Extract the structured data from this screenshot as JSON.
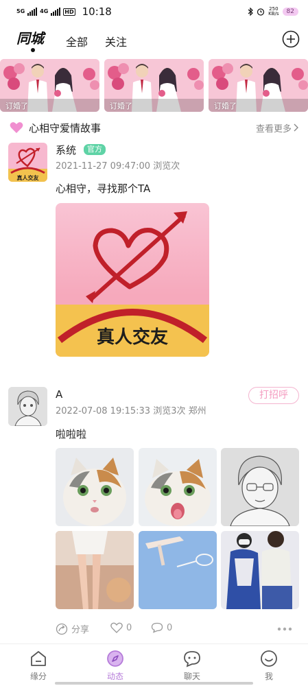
{
  "status_bar": {
    "net1": "5G",
    "net2": "4G",
    "hd": "HD",
    "time": "10:18",
    "speed_value": "250",
    "speed_unit": "KB/s",
    "battery": "82"
  },
  "top_nav": {
    "active_tab": "同城",
    "tabs": [
      "全部",
      "关注"
    ],
    "add_icon": "plus-circle-icon"
  },
  "banners": [
    {
      "label": "订婚了",
      "icon": "wedding-couple-image"
    },
    {
      "label": "订婚了",
      "icon": "wedding-couple-image"
    },
    {
      "label": "订婚了",
      "icon": "wedding-couple-image"
    }
  ],
  "love_story": {
    "icon": "pink-heart-icon",
    "title": "心相守爱情故事",
    "see_more": "查看更多"
  },
  "post1": {
    "author": "系统",
    "badge": "官方",
    "meta": "2021-11-27 09:47:00 浏览次",
    "content": "心相守，寻找那个TA",
    "image_caption": "真人交友",
    "avatar_caption": "真人交友"
  },
  "post2": {
    "author": "A",
    "greet_button": "打招呼",
    "meta": "2022-07-08 19:15:33 浏览3次 郑州",
    "content": "啦啦啦",
    "actions": {
      "share": "分享",
      "like_count": "0",
      "comment_count": "0"
    }
  },
  "tabbar": [
    {
      "label": "缘分",
      "icon": "home-icon",
      "active": false
    },
    {
      "label": "动态",
      "icon": "compass-icon",
      "active": true
    },
    {
      "label": "聊天",
      "icon": "chat-icon",
      "active": false
    },
    {
      "label": "我",
      "icon": "smile-icon",
      "active": false
    }
  ],
  "colors": {
    "accent": "#b57bd9",
    "official_badge": "#5fd3a6",
    "greet_border": "#f4b4cf",
    "heart": "#f08fd0"
  }
}
